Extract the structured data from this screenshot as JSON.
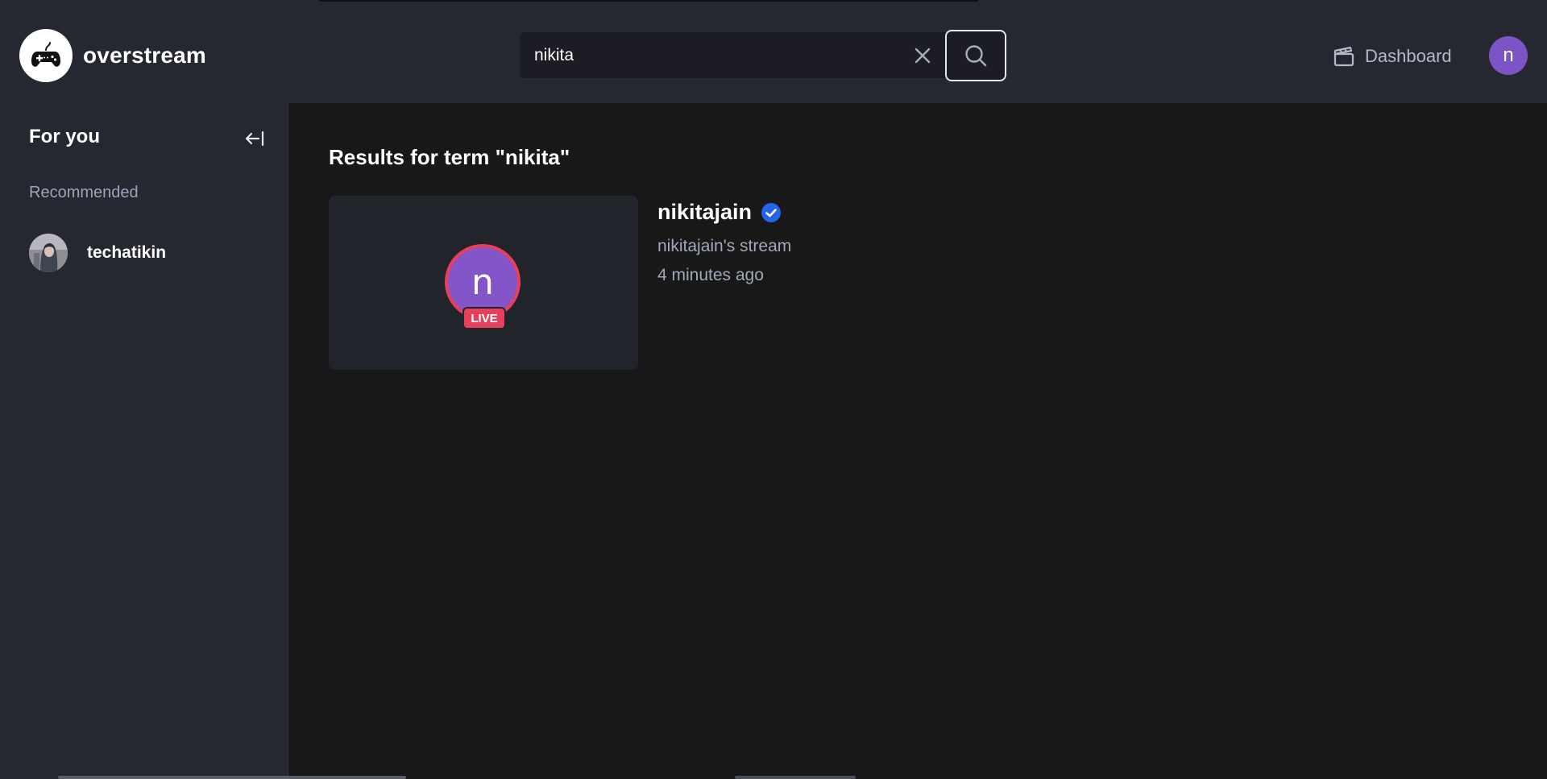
{
  "brand": {
    "name": "overstream",
    "icon": "gamepad-icon"
  },
  "search": {
    "value": "nikita",
    "placeholder": "Search",
    "clear_icon": "close-icon",
    "submit_icon": "search-icon"
  },
  "header": {
    "dashboard_label": "Dashboard",
    "dashboard_icon": "clapperboard-icon",
    "user_avatar_initial": "n"
  },
  "sidebar": {
    "title": "For you",
    "collapse_icon": "arrow-left-to-line-icon",
    "section_label": "Recommended",
    "items": [
      {
        "name": "techatikin",
        "avatar": "user-photo"
      }
    ]
  },
  "main": {
    "title": "Results for term \"nikita\"",
    "results": [
      {
        "username": "nikitajain",
        "verified": true,
        "stream_name": "nikitajain's stream",
        "time_ago": "4 minutes ago",
        "avatar_initial": "n",
        "live_label": "LIVE"
      }
    ]
  },
  "colors": {
    "nav_bg": "#252731",
    "main_bg": "#181818",
    "accent_live": "#e83f5a",
    "avatar_purple": "#7c54c6",
    "verified_blue": "#2563eb"
  }
}
